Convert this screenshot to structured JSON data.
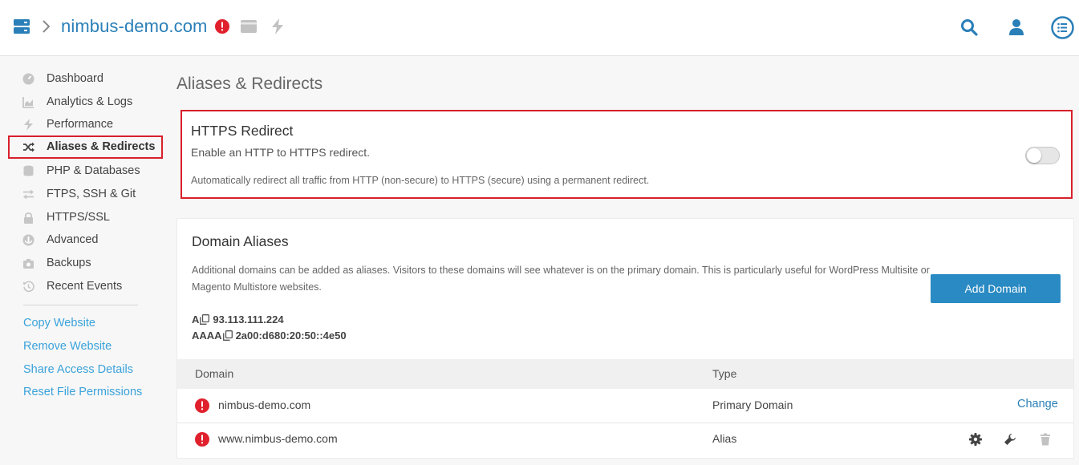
{
  "header": {
    "site_name": "nimbus-demo.com"
  },
  "sidebar": {
    "items": [
      {
        "label": "Dashboard",
        "icon": "dashboard-icon"
      },
      {
        "label": "Analytics & Logs",
        "icon": "chart-icon"
      },
      {
        "label": "Performance",
        "icon": "bolt-icon"
      },
      {
        "label": "Aliases & Redirects",
        "icon": "shuffle-icon",
        "active": true
      },
      {
        "label": "PHP & Databases",
        "icon": "database-icon"
      },
      {
        "label": "FTPS, SSH & Git",
        "icon": "transfer-icon"
      },
      {
        "label": "HTTPS/SSL",
        "icon": "lock-icon"
      },
      {
        "label": "Advanced",
        "icon": "advanced-icon"
      },
      {
        "label": "Backups",
        "icon": "camera-icon"
      },
      {
        "label": "Recent Events",
        "icon": "history-icon"
      }
    ],
    "links": [
      {
        "label": "Copy Website"
      },
      {
        "label": "Remove Website"
      },
      {
        "label": "Share Access Details"
      },
      {
        "label": "Reset File Permissions"
      }
    ]
  },
  "main": {
    "page_title": "Aliases & Redirects",
    "https_redirect": {
      "title": "HTTPS Redirect",
      "subtitle": "Enable an HTTP to HTTPS redirect.",
      "description": "Automatically redirect all traffic from HTTP (non-secure) to HTTPS (secure) using a permanent redirect.",
      "enabled": false
    },
    "domain_aliases": {
      "title": "Domain Aliases",
      "description": "Additional domains can be added as aliases. Visitors to these domains will see whatever is on the primary domain. This is particularly useful for WordPress Multisite or Magento Multistore websites.",
      "add_button": "Add Domain",
      "dns": [
        {
          "label": "A",
          "value": "93.113.111.224"
        },
        {
          "label": "AAAA",
          "value": "2a00:d680:20:50::4e50"
        }
      ],
      "table": {
        "columns": [
          "Domain",
          "Type"
        ],
        "rows": [
          {
            "domain": "nimbus-demo.com",
            "type": "Primary Domain",
            "action": "Change"
          },
          {
            "domain": "www.nimbus-demo.com",
            "type": "Alias"
          }
        ]
      }
    }
  },
  "colors": {
    "accent": "#2a7fb8",
    "link": "#3aa2db",
    "button": "#2a8ac3",
    "alert": "#e0202c",
    "highlight_border": "#d8202c"
  }
}
